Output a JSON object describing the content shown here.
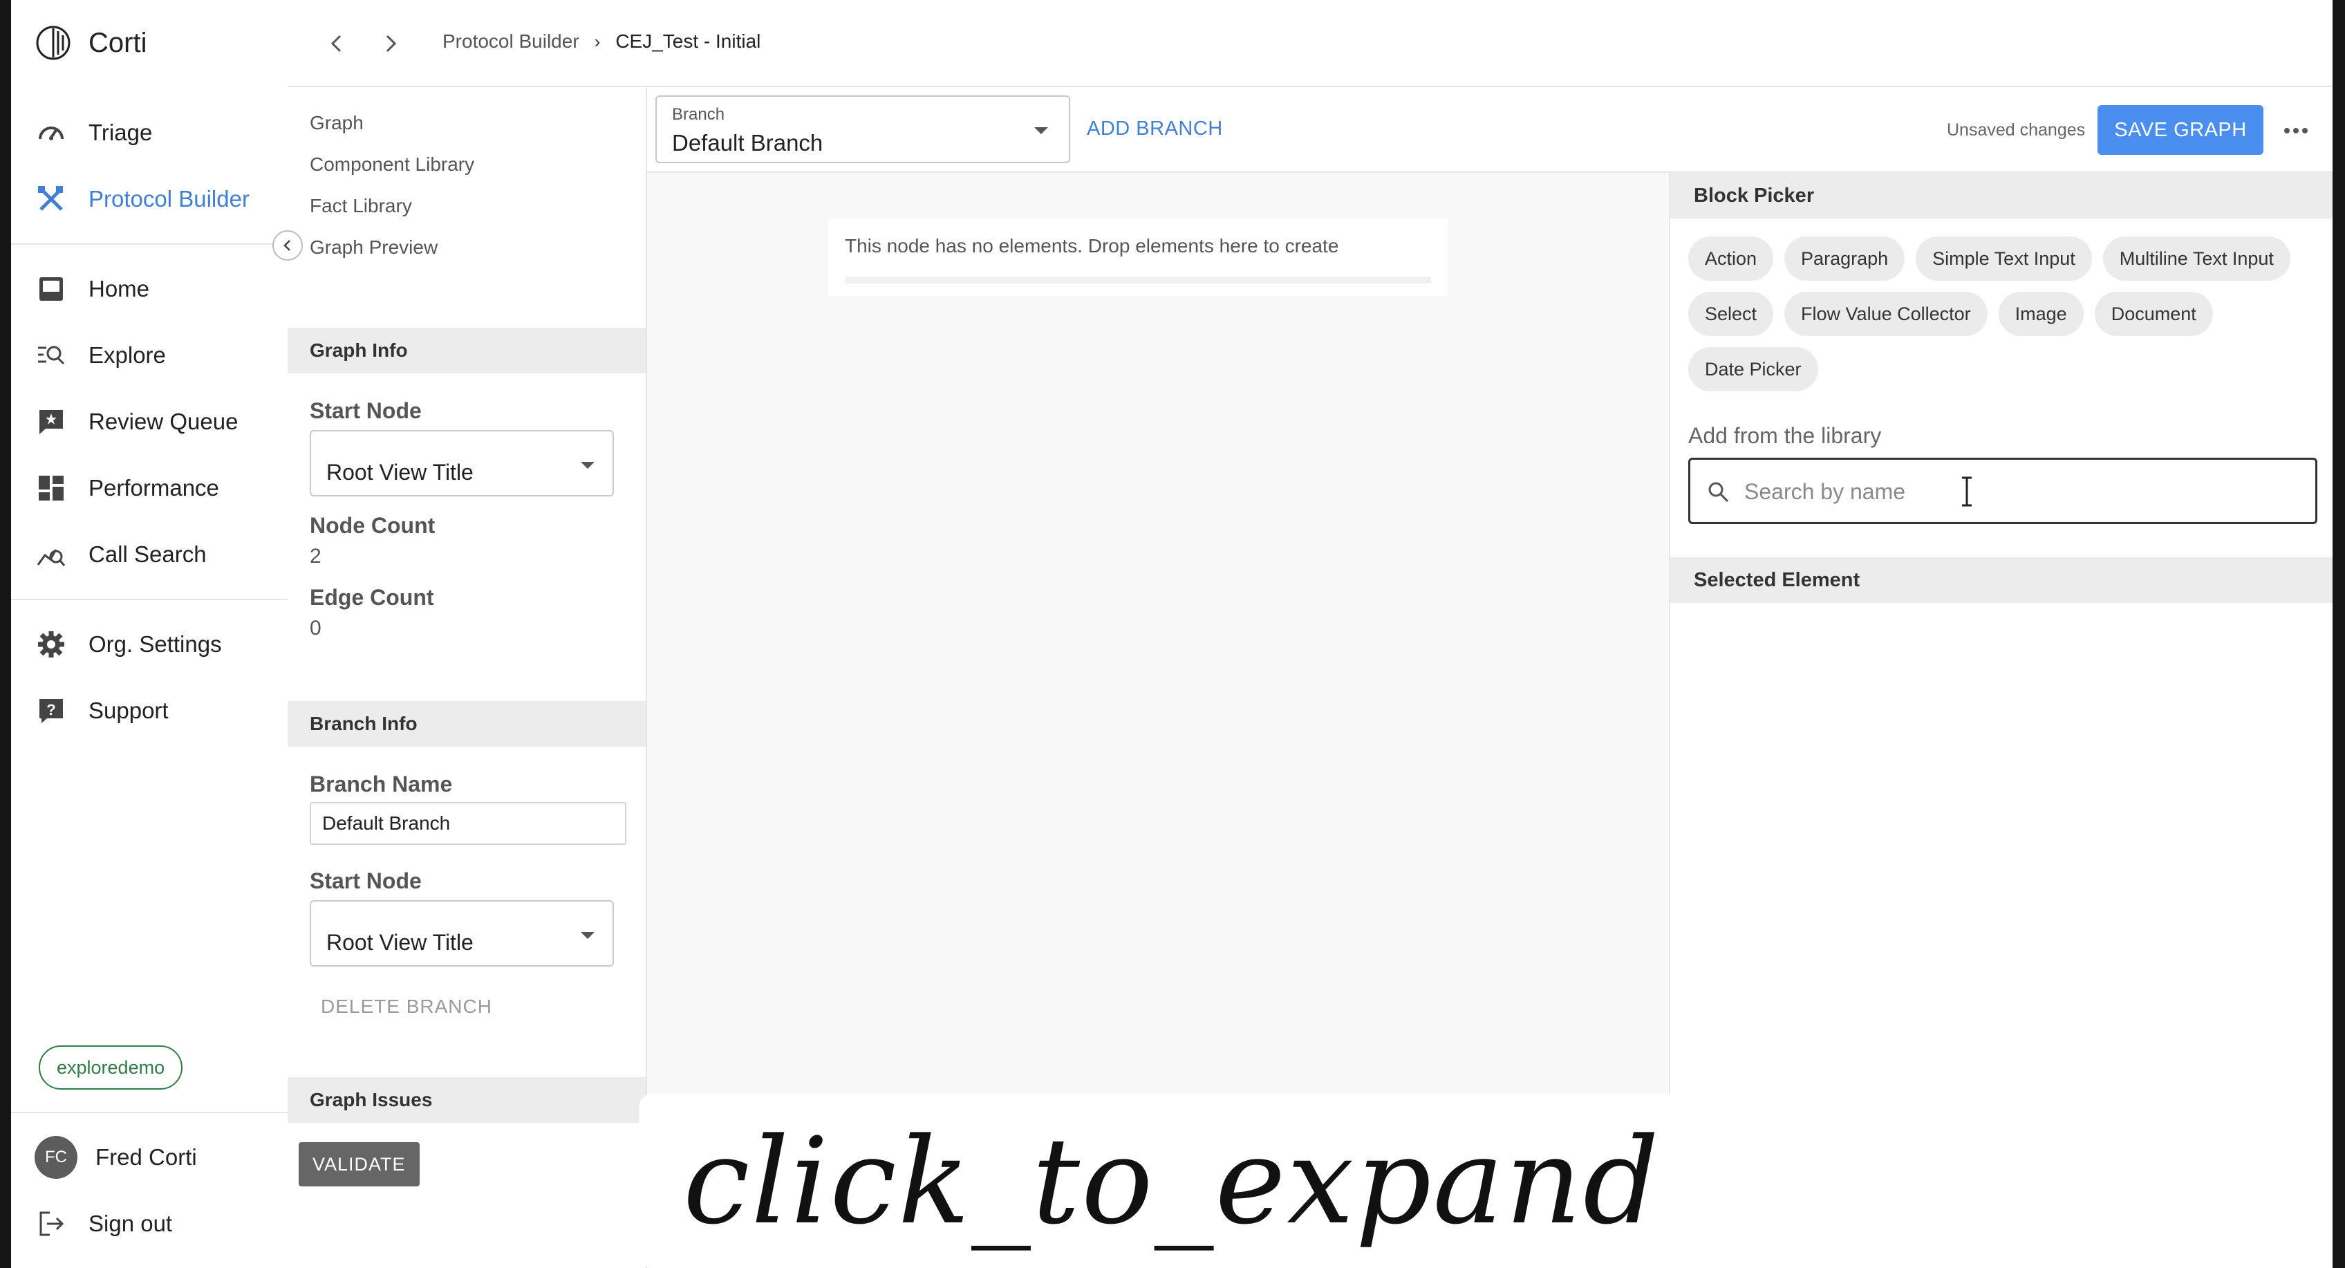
{
  "app": {
    "name": "Corti"
  },
  "sidebar": {
    "items": [
      {
        "label": "Triage",
        "icon": "gauge-icon",
        "active": false
      },
      {
        "label": "Protocol Builder",
        "icon": "tools-icon",
        "active": true
      },
      {
        "label": "Home",
        "icon": "inbox-icon",
        "active": false
      },
      {
        "label": "Explore",
        "icon": "explore-search-icon",
        "active": false
      },
      {
        "label": "Review Queue",
        "icon": "review-queue-icon",
        "active": false
      },
      {
        "label": "Performance",
        "icon": "dashboard-icon",
        "active": false
      },
      {
        "label": "Call Search",
        "icon": "call-search-icon",
        "active": false
      },
      {
        "label": "Org. Settings",
        "icon": "gear-icon",
        "active": false
      },
      {
        "label": "Support",
        "icon": "help-icon",
        "active": false
      }
    ],
    "environment": "exploredemo",
    "user": {
      "initials": "FC",
      "name": "Fred Corti"
    },
    "sign_out": "Sign out"
  },
  "topbar": {
    "breadcrumb": [
      "Protocol Builder",
      "CEJ_Test - Initial"
    ]
  },
  "subnav": {
    "links": [
      "Graph",
      "Component Library",
      "Fact Library",
      "Graph Preview"
    ]
  },
  "graph_info": {
    "title": "Graph Info",
    "start_node_label": "Start Node",
    "start_node_value": "Root View Title",
    "node_count_label": "Node Count",
    "node_count": "2",
    "edge_count_label": "Edge Count",
    "edge_count": "0"
  },
  "branch_info": {
    "title": "Branch Info",
    "branch_name_label": "Branch Name",
    "branch_name_value": "Default Branch",
    "start_node_label": "Start Node",
    "start_node_value": "Root View Title",
    "delete_label": "DELETE BRANCH"
  },
  "graph_issues": {
    "title": "Graph Issues",
    "validate_label": "VALIDATE"
  },
  "toolbar": {
    "branch_label": "Branch",
    "branch_value": "Default Branch",
    "add_branch": "ADD BRANCH",
    "status": "Unsaved changes",
    "save_label": "SAVE GRAPH"
  },
  "canvas": {
    "empty_node_message": "This node has no elements. Drop elements here to create"
  },
  "block_picker": {
    "title": "Block Picker",
    "blocks": [
      "Action",
      "Paragraph",
      "Simple Text Input",
      "Multiline Text Input",
      "Select",
      "Flow Value Collector",
      "Image",
      "Document",
      "Date Picker"
    ],
    "library_label": "Add from the library",
    "search_placeholder": "Search by name",
    "selected_title": "Selected Element"
  },
  "overlay": {
    "caption": "click_to_expand"
  },
  "colors": {
    "accent": "#3f7fd6",
    "save_button": "#4a8ef0",
    "env_chip": "#2f7d45"
  }
}
